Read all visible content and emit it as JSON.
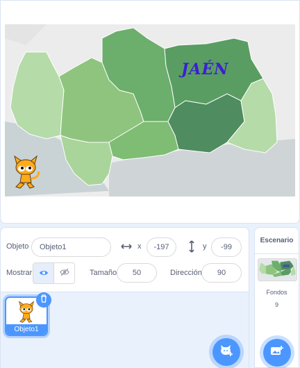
{
  "stage": {
    "map_label": "JAÉN"
  },
  "sprite_info": {
    "sprite_label": "Objeto",
    "sprite_name": "Objeto1",
    "x_label": "x",
    "x_value": "-197",
    "y_label": "y",
    "y_value": "-99",
    "show_label": "Mostrar",
    "size_label": "Tamaño",
    "size_value": "50",
    "direction_label": "Dirección",
    "direction_value": "90"
  },
  "sprite_list": {
    "items": [
      {
        "name": "Objeto1"
      }
    ]
  },
  "stage_selector": {
    "title": "Escenario",
    "backdrops_label": "Fondos",
    "backdrops_count": "9"
  },
  "colors": {
    "accent": "#4c97ff",
    "selected_province": "#4f8c5f",
    "map_label": "#3b1fd6"
  },
  "icons": {
    "show": "eye-icon",
    "hide": "eye-slash-icon",
    "x_axis": "horizontal-arrows-icon",
    "y_axis": "vertical-arrows-icon",
    "delete": "trash-icon",
    "choose_sprite": "cat-plus-icon",
    "choose_backdrop": "image-plus-icon"
  }
}
